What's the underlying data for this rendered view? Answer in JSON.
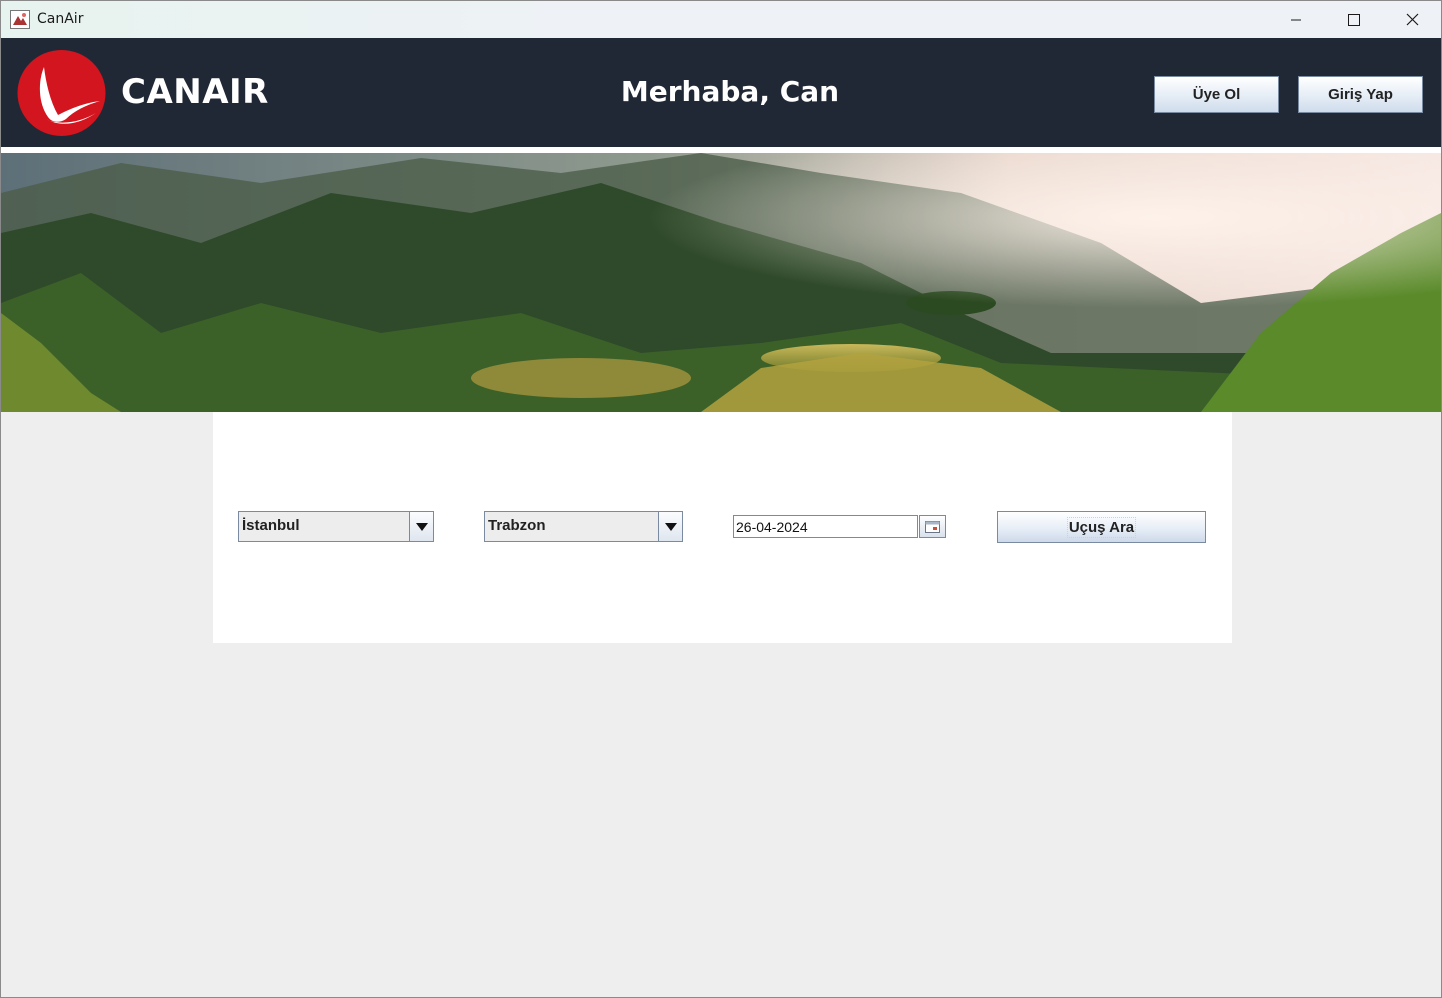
{
  "window": {
    "title": "CanAir"
  },
  "header": {
    "brand": "CANAIR",
    "greeting": "Merhaba, Can",
    "register_label": "Üye Ol",
    "login_label": "Giriş Yap"
  },
  "search": {
    "from_city": "İstanbul",
    "to_city": "Trabzon",
    "date": "26-04-2024",
    "search_label": "Uçuş Ara"
  },
  "icons": {
    "app": "app-icon",
    "minimize": "minimize-icon",
    "maximize": "maximize-icon",
    "close": "close-icon",
    "logo": "bird-logo-icon",
    "dropdown": "chevron-down-icon",
    "calendar": "calendar-icon"
  },
  "colors": {
    "header_bg": "#212835",
    "logo_red": "#d2151e",
    "panel_bg": "#ffffff",
    "window_bg": "#eeeeee"
  }
}
